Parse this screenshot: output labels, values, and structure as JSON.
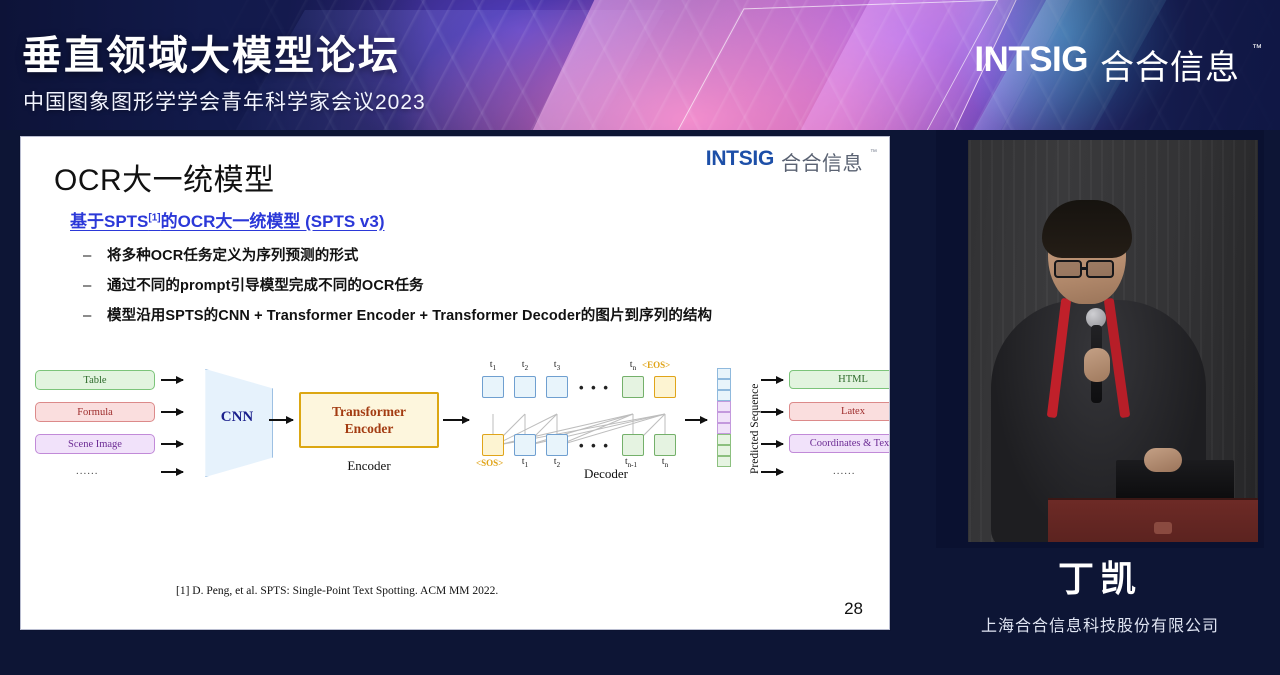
{
  "banner": {
    "event_title": "垂直领域大模型论坛",
    "event_subtitle": "中国图象图形学学会青年科学家会议2023",
    "brand_en": "INTSIG",
    "brand_cn": "合合信息",
    "brand_tm": "™"
  },
  "slide": {
    "logo_en": "INTSIG",
    "logo_cn": "合合信息",
    "logo_tm": "™",
    "title": "OCR大一统模型",
    "subtitle_prefix": "基于SPTS",
    "subtitle_sup": "[1]",
    "subtitle_suffix": "的OCR大一统模型 (SPTS v3)",
    "bullets": [
      {
        "dash": "–",
        "text": "将多种OCR任务定义为序列预测的形式"
      },
      {
        "dash": "–",
        "text": "通过不同的prompt引导模型完成不同的OCR任务"
      },
      {
        "dash": "–",
        "text": "模型沿用SPTS的CNN + Transformer Encoder + Transformer Decoder的图片到序列的结构"
      }
    ],
    "footnote": "[1] D. Peng, et al. SPTS: Single-Point Text Spotting. ACM MM 2022.",
    "page_number": "28"
  },
  "diagram": {
    "inputs": [
      {
        "label": "Table",
        "color": "green"
      },
      {
        "label": "Formula",
        "color": "red"
      },
      {
        "label": "Scene Image",
        "color": "purple"
      }
    ],
    "input_ellipsis": "......",
    "cnn_label": "CNN",
    "encoder_box_line1": "Transformer",
    "encoder_box_line2": "Encoder",
    "encoder_caption": "Encoder",
    "decoder_caption": "Decoder",
    "decoder_top_tokens": [
      {
        "label": "t",
        "sub": "1",
        "color": "blue"
      },
      {
        "label": "t",
        "sub": "2",
        "color": "blue"
      },
      {
        "label": "t",
        "sub": "3",
        "color": "blue"
      },
      {
        "label": "t",
        "sub": "n",
        "color": "green"
      }
    ],
    "decoder_top_special": "<EOS>",
    "decoder_bottom_special": "<SOS>",
    "decoder_bottom_tokens": [
      {
        "label": "t",
        "sub": "1",
        "color": "blue"
      },
      {
        "label": "t",
        "sub": "2",
        "color": "blue"
      },
      {
        "label": "t",
        "sub": "n-1",
        "color": "green"
      },
      {
        "label": "t",
        "sub": "n",
        "color": "green"
      }
    ],
    "decoder_ellipsis": "• • •",
    "predicted_sequence_label": "Predicted Sequence",
    "sequence_cells": [
      "b",
      "b",
      "b",
      "p",
      "p",
      "p",
      "g",
      "g",
      "g"
    ],
    "outputs": [
      {
        "label": "HTML",
        "color": "green"
      },
      {
        "label": "Latex",
        "color": "red"
      },
      {
        "label": "Coordinates & Texts",
        "color": "purple"
      }
    ],
    "output_ellipsis": "......"
  },
  "speaker": {
    "name": "丁凯",
    "org": "上海合合信息科技股份有限公司"
  },
  "colors": {
    "accent_blue": "#2b38d8",
    "banner_navy": "#14134a",
    "page_bg": "#0d1535",
    "brand_blue": "#1d4fa8"
  }
}
